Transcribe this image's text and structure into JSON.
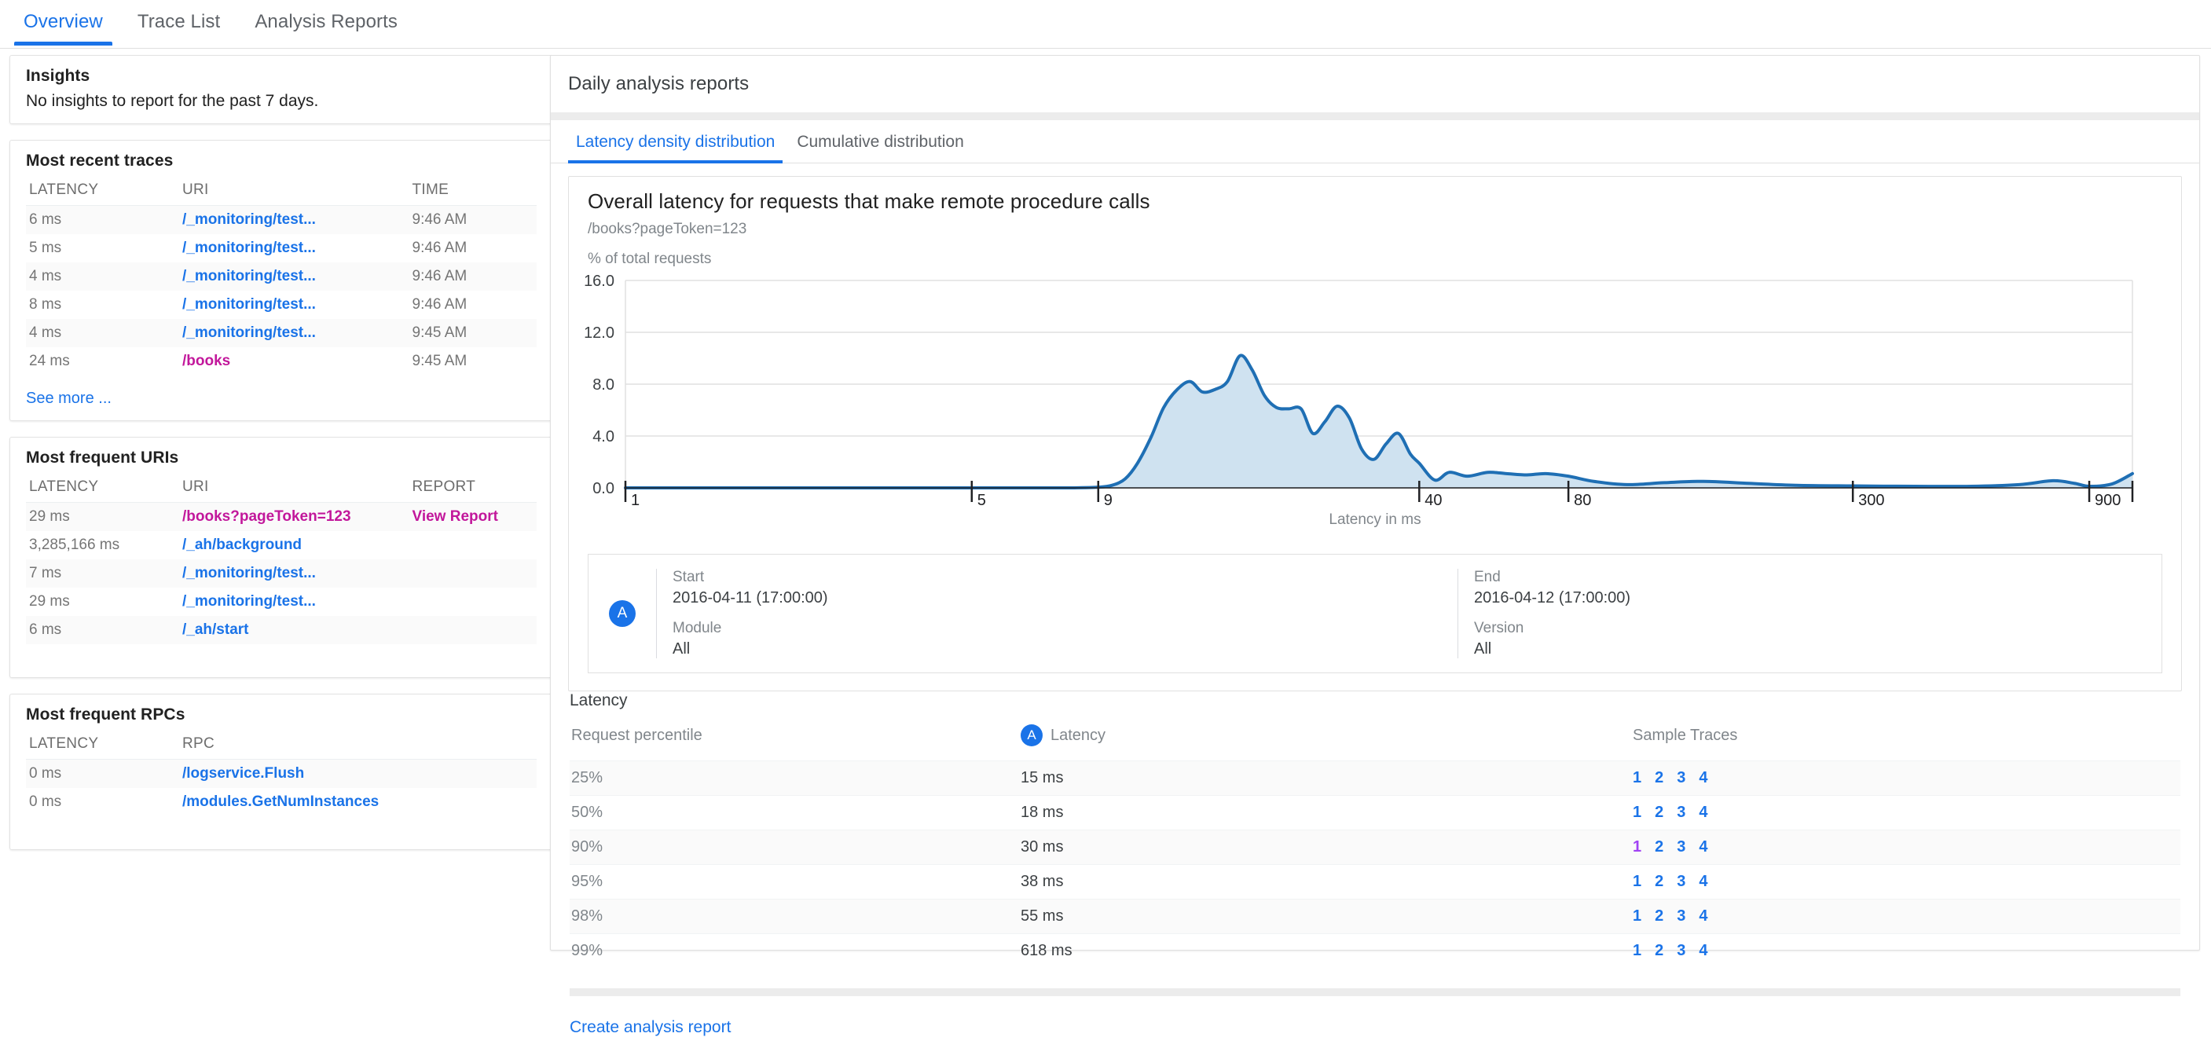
{
  "top_tabs": [
    {
      "label": "Overview",
      "active": true
    },
    {
      "label": "Trace List",
      "active": false
    },
    {
      "label": "Analysis Reports",
      "active": false
    }
  ],
  "insights": {
    "title": "Insights",
    "message": "No insights to report for the past 7 days."
  },
  "recent_traces": {
    "title": "Most recent traces",
    "headers": [
      "LATENCY",
      "URI",
      "TIME"
    ],
    "rows": [
      {
        "latency": "6 ms",
        "uri": "/_monitoring/test...",
        "time": "9:46 AM",
        "visited": false
      },
      {
        "latency": "5 ms",
        "uri": "/_monitoring/test...",
        "time": "9:46 AM",
        "visited": false
      },
      {
        "latency": "4 ms",
        "uri": "/_monitoring/test...",
        "time": "9:46 AM",
        "visited": false
      },
      {
        "latency": "8 ms",
        "uri": "/_monitoring/test...",
        "time": "9:46 AM",
        "visited": false
      },
      {
        "latency": "4 ms",
        "uri": "/_monitoring/test...",
        "time": "9:45 AM",
        "visited": false
      },
      {
        "latency": "24 ms",
        "uri": "/books",
        "time": "9:45 AM",
        "visited": true
      }
    ],
    "see_more": "See more ..."
  },
  "frequent_uris": {
    "title": "Most frequent URIs",
    "headers": [
      "LATENCY",
      "URI",
      "REPORT"
    ],
    "rows": [
      {
        "latency": "29 ms",
        "uri": "/books?pageToken=123",
        "report": "View Report",
        "visited": true
      },
      {
        "latency": "3,285,166 ms",
        "uri": "/_ah/background",
        "report": "",
        "visited": false
      },
      {
        "latency": "7 ms",
        "uri": "/_monitoring/test...",
        "report": "",
        "visited": false
      },
      {
        "latency": "29 ms",
        "uri": "/_monitoring/test...",
        "report": "",
        "visited": false
      },
      {
        "latency": "6 ms",
        "uri": "/_ah/start",
        "report": "",
        "visited": false
      }
    ]
  },
  "frequent_rpcs": {
    "title": "Most frequent RPCs",
    "headers": [
      "LATENCY",
      "RPC"
    ],
    "rows": [
      {
        "latency": "0 ms",
        "rpc": "/logservice.Flush"
      },
      {
        "latency": "0 ms",
        "rpc": "/modules.GetNumInstances"
      }
    ]
  },
  "panel": {
    "title": "Daily analysis reports",
    "tabs": [
      {
        "label": "Latency density distribution",
        "active": true
      },
      {
        "label": "Cumulative distribution",
        "active": false
      }
    ],
    "create_link": "Create analysis report"
  },
  "meta": {
    "avatar": "A",
    "start_label": "Start",
    "start_value": "2016-04-11 (17:00:00)",
    "module_label": "Module",
    "module_value": "All",
    "end_label": "End",
    "end_value": "2016-04-12 (17:00:00)",
    "version_label": "Version",
    "version_value": "All"
  },
  "latency_section": {
    "title": "Latency",
    "headers": {
      "percentile": "Request percentile",
      "latency": "Latency",
      "latency_avatar": "A",
      "samples": "Sample Traces"
    },
    "rows": [
      {
        "percentile": "25%",
        "latency": "15 ms",
        "samples": [
          "1",
          "2",
          "3",
          "4"
        ],
        "visited_index": -1
      },
      {
        "percentile": "50%",
        "latency": "18 ms",
        "samples": [
          "1",
          "2",
          "3",
          "4"
        ],
        "visited_index": -1
      },
      {
        "percentile": "90%",
        "latency": "30 ms",
        "samples": [
          "1",
          "2",
          "3",
          "4"
        ],
        "visited_index": 0
      },
      {
        "percentile": "95%",
        "latency": "38 ms",
        "samples": [
          "1",
          "2",
          "3",
          "4"
        ],
        "visited_index": -1
      },
      {
        "percentile": "98%",
        "latency": "55 ms",
        "samples": [
          "1",
          "2",
          "3",
          "4"
        ],
        "visited_index": -1
      },
      {
        "percentile": "99%",
        "latency": "618 ms",
        "samples": [
          "1",
          "2",
          "3",
          "4"
        ],
        "visited_index": -1
      }
    ]
  },
  "colors": {
    "accent": "#1a73e8",
    "visited_link": "#a142f4",
    "magenta_link": "#c2179b",
    "chart_line": "#1f6fb4",
    "chart_fill": "#cfe2f0",
    "text_muted": "#80868b"
  },
  "chart_data": {
    "type": "area",
    "title": "Overall latency for requests that make remote procedure calls",
    "subtitle": "/books?pageToken=123",
    "ylabel": "% of total requests",
    "xlabel": "Latency in ms",
    "xscale": "log",
    "xticks": [
      1,
      5,
      9,
      40,
      80,
      300,
      900
    ],
    "xticklabels": [
      "1",
      "5",
      "9",
      "40",
      "80",
      "300",
      "900"
    ],
    "xlim": [
      1,
      1100
    ],
    "yticks": [
      0.0,
      4.0,
      8.0,
      12.0,
      16.0
    ],
    "yticklabels": [
      "0.0",
      "4.0",
      "8.0",
      "12.0",
      "16.0"
    ],
    "ylim": [
      0,
      16
    ],
    "grid": true,
    "legend": "none",
    "x": [
      1.0,
      2.0,
      3.0,
      4.0,
      5.0,
      6.0,
      7.0,
      8.0,
      9.0,
      9.6,
      10.2,
      10.8,
      11.5,
      12.2,
      13.0,
      13.8,
      14.6,
      15.5,
      16.4,
      17.4,
      18.4,
      19.5,
      20.6,
      21.8,
      23.1,
      24.4,
      25.8,
      27.3,
      28.9,
      30.6,
      32.4,
      34.3,
      36.3,
      38.4,
      40.0,
      43.0,
      46.0,
      50.0,
      55.0,
      60.0,
      66.0,
      72.0,
      80.0,
      90.0,
      105.0,
      125.0,
      150.0,
      185.0,
      230.0,
      300.0,
      400.0,
      520.0,
      650.0,
      760.0,
      840.0,
      900.0,
      1000.0,
      1100.0
    ],
    "y": [
      0.0,
      0.0,
      0.0,
      0.0,
      0.0,
      0.0,
      0.0,
      0.0,
      0.05,
      0.2,
      0.7,
      1.9,
      3.9,
      6.2,
      7.6,
      8.2,
      7.4,
      7.6,
      8.2,
      10.2,
      9.1,
      7.1,
      6.2,
      6.1,
      6.1,
      4.2,
      5.1,
      6.3,
      5.4,
      3.0,
      2.2,
      3.4,
      4.2,
      2.6,
      1.9,
      0.6,
      1.2,
      0.9,
      1.2,
      1.1,
      1.0,
      1.1,
      0.9,
      0.5,
      0.25,
      0.4,
      0.5,
      0.35,
      0.2,
      0.15,
      0.12,
      0.12,
      0.25,
      0.55,
      0.35,
      0.12,
      0.3,
      1.1
    ]
  }
}
